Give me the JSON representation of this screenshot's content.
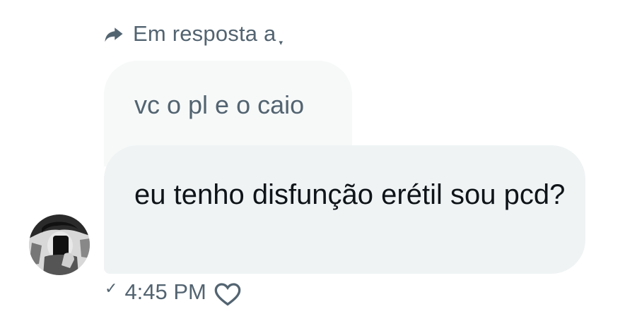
{
  "reply_context": {
    "label": "Em resposta a",
    "icon": "reply-arrow-icon"
  },
  "quoted_message": {
    "text": "vc o pl e o caio"
  },
  "message": {
    "text": "eu tenho disfunção erétil sou pcd?"
  },
  "meta": {
    "time": "4:45 PM",
    "status_icon": "check-icon",
    "reaction_icon": "heart-icon"
  },
  "colors": {
    "muted_text": "#536471",
    "primary_text": "#0f1419",
    "bubble_bg": "#eff3f4",
    "quoted_bg": "#f7f9f9"
  }
}
